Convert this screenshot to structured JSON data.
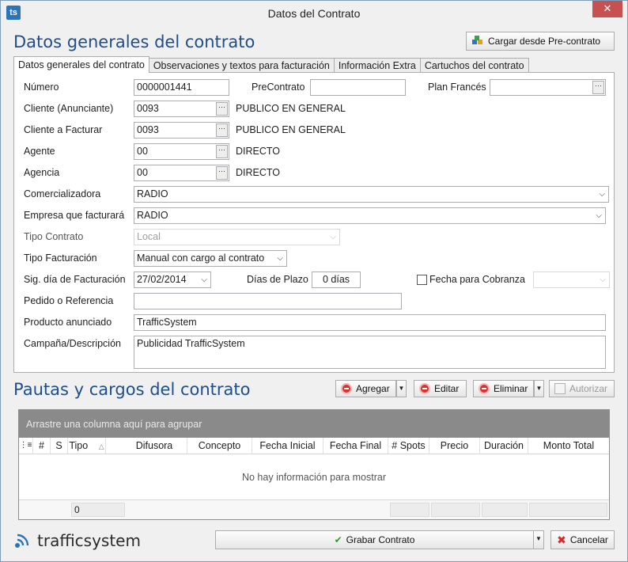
{
  "window": {
    "title": "Datos del Contrato",
    "close_glyph": "✕",
    "app_icon_text": "ts"
  },
  "header": {
    "title": "Datos generales del contrato",
    "load_button": "Cargar desde Pre-contrato"
  },
  "tabs": [
    {
      "label": "Datos generales del contrato"
    },
    {
      "label": "Observaciones y textos para facturación"
    },
    {
      "label": "Información Extra"
    },
    {
      "label": "Cartuchos del contrato"
    }
  ],
  "form": {
    "numero": {
      "label": "Número",
      "value": "0000001441"
    },
    "precontrato": {
      "label": "PreContrato",
      "value": ""
    },
    "plan_frances": {
      "label": "Plan Francés",
      "value": ""
    },
    "cliente": {
      "label": "Cliente (Anunciante)",
      "code": "0093",
      "name": "PUBLICO EN GENERAL"
    },
    "cliente_facturar": {
      "label": "Cliente a Facturar",
      "code": "0093",
      "name": "PUBLICO EN GENERAL"
    },
    "agente": {
      "label": "Agente",
      "code": "00",
      "name": "DIRECTO"
    },
    "agencia": {
      "label": "Agencia",
      "code": "00",
      "name": "DIRECTO"
    },
    "comercializadora": {
      "label": "Comercializadora",
      "value": "RADIO"
    },
    "empresa_factura": {
      "label": "Empresa que facturará",
      "value": "RADIO"
    },
    "tipo_contrato": {
      "label": "Tipo Contrato",
      "value": "Local"
    },
    "tipo_facturacion": {
      "label": "Tipo Facturación",
      "value": "Manual con cargo al contrato"
    },
    "sig_dia": {
      "label": "Sig. día de Facturación",
      "value": "27/02/2014"
    },
    "dias_plazo": {
      "label": "Días de Plazo",
      "value": "0 días"
    },
    "fecha_cobranza": {
      "label": "Fecha para Cobranza",
      "checked": false,
      "value": ""
    },
    "pedido": {
      "label": "Pedido o Referencia",
      "value": ""
    },
    "producto": {
      "label": "Producto anunciado",
      "value": "TrafficSystem"
    },
    "campana": {
      "label": "Campaña/Descripción",
      "value": "Publicidad TrafficSystem"
    }
  },
  "pautas": {
    "title": "Pautas y cargos del contrato",
    "add": "Agregar",
    "edit": "Editar",
    "delete": "Eliminar",
    "authorize": "Autorizar",
    "group_hint": "Arrastre una columna aquí para agrupar",
    "columns": [
      "#",
      "S",
      "Tipo",
      "Difusora",
      "Concepto",
      "Fecha Inicial",
      "Fecha Final",
      "# Spots",
      "Precio",
      "Duración",
      "Monto Total"
    ],
    "empty": "No hay información para mostrar",
    "footer_count": "0"
  },
  "footer": {
    "brand": "trafficsystem",
    "save": "Grabar Contrato",
    "cancel": "Cancelar"
  },
  "colors": {
    "accent": "#1f4e8c",
    "close": "#c75050",
    "group_bar": "#8a8a8a"
  }
}
